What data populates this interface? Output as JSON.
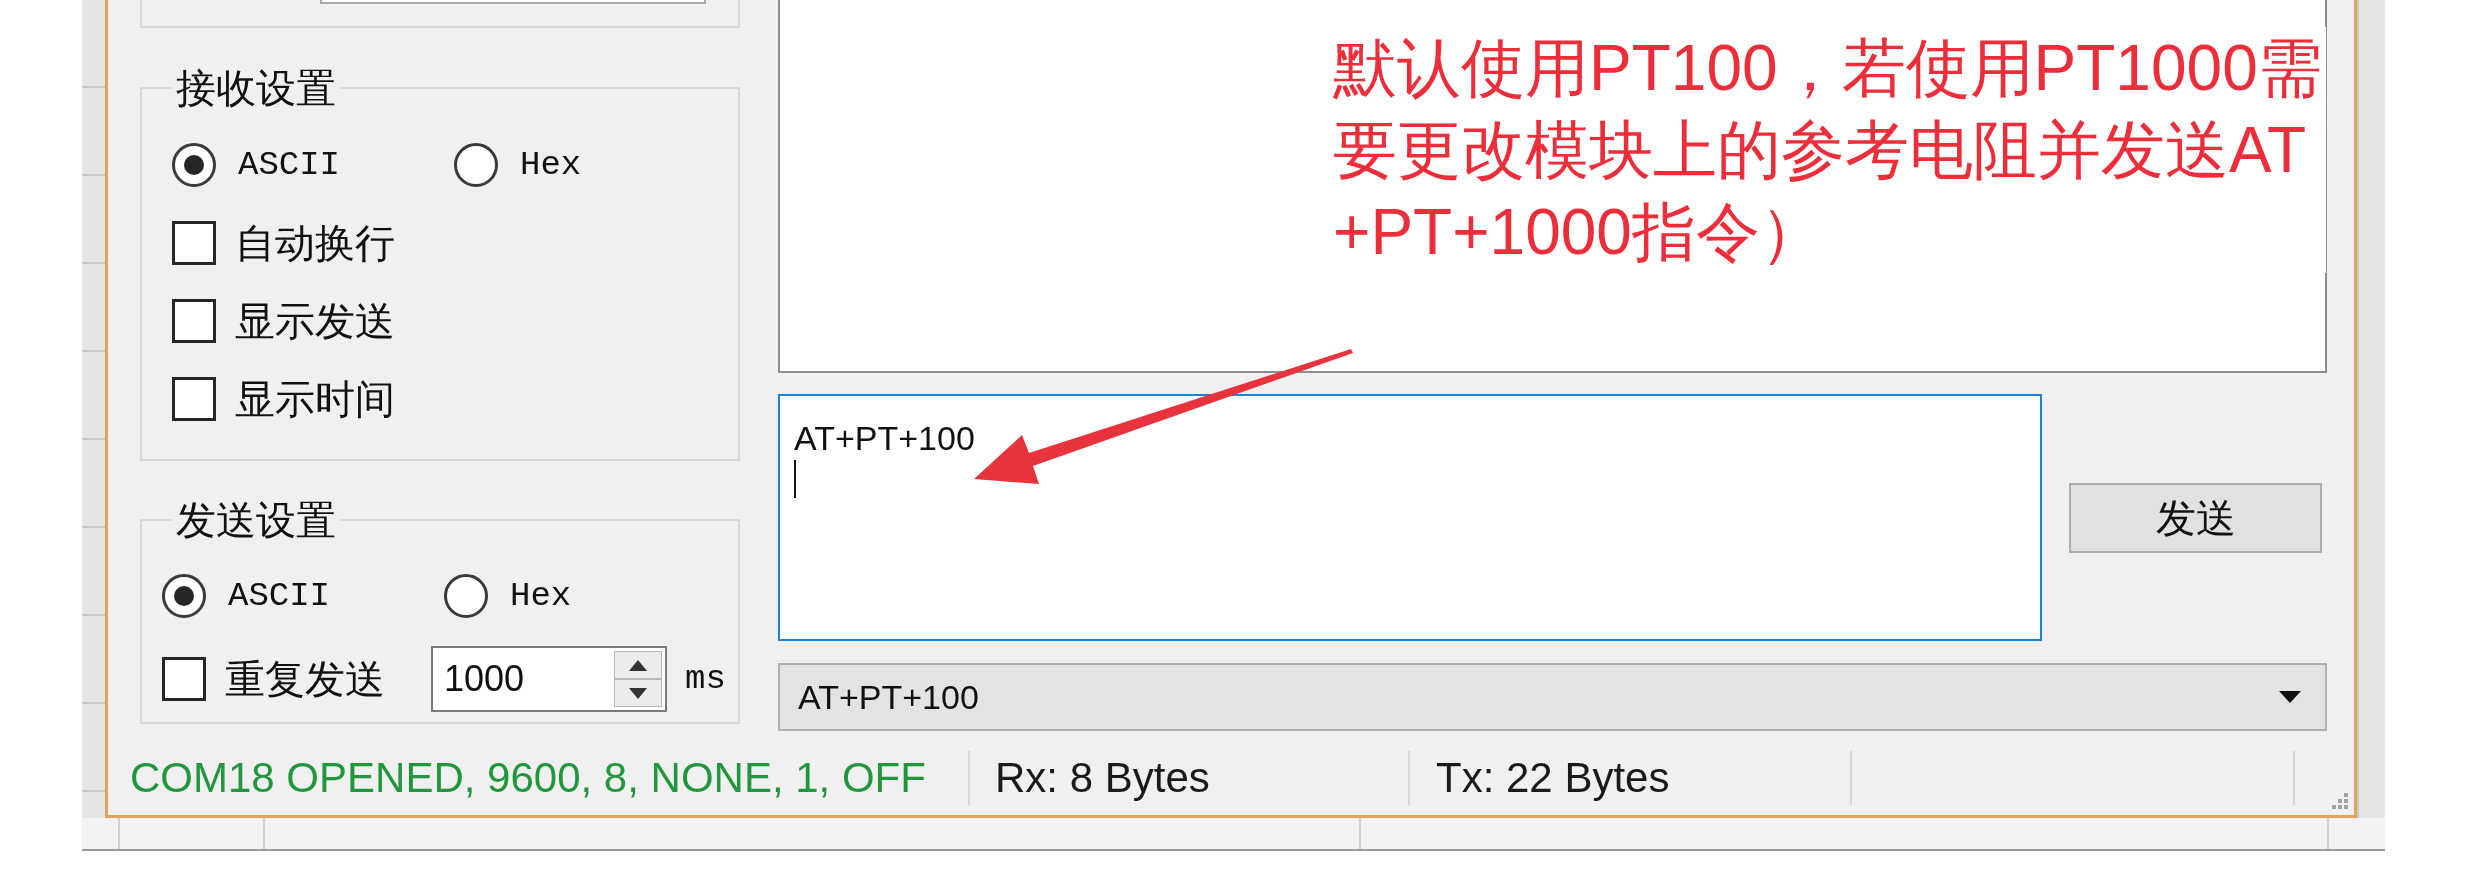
{
  "receive_settings": {
    "title": "接收设置",
    "formats": [
      {
        "label": "ASCII",
        "selected": true
      },
      {
        "label": "Hex",
        "selected": false
      }
    ],
    "options": [
      {
        "label": "自动换行",
        "checked": false
      },
      {
        "label": "显示发送",
        "checked": false
      },
      {
        "label": "显示时间",
        "checked": false
      }
    ]
  },
  "send_settings": {
    "title": "发送设置",
    "formats": [
      {
        "label": "ASCII",
        "selected": true
      },
      {
        "label": "Hex",
        "selected": false
      }
    ],
    "repeat": {
      "label": "重复发送",
      "checked": false,
      "interval": "1000",
      "unit": "ms"
    }
  },
  "send_input": {
    "value": "AT+PT+100"
  },
  "send_button": {
    "label": "发送"
  },
  "history": {
    "value": "AT+PT+100"
  },
  "status_bar": {
    "sections": [
      {
        "text": "COM18 OPENED, 9600, 8, NONE, 1, OFF",
        "color": "#22963c"
      },
      {
        "text": "Rx: 8 Bytes",
        "color": "#1a1a1a"
      },
      {
        "text": "Tx: 22 Bytes",
        "color": "#1a1a1a"
      }
    ]
  },
  "annotation": {
    "lines": [
      "默认使用PT100，若使用PT1000需",
      "要更改模块上的参考电阻并发送AT",
      "+PT+1000指令）"
    ]
  }
}
